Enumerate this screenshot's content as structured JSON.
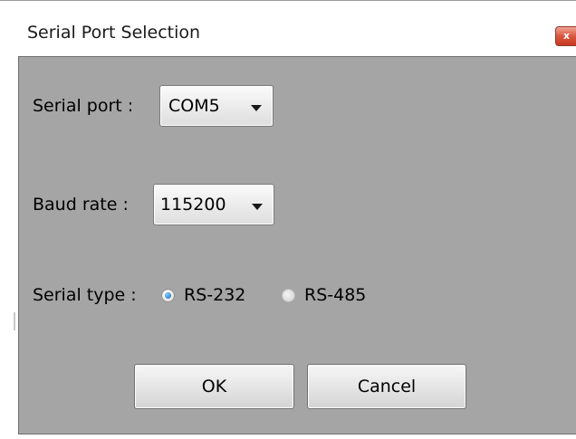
{
  "window": {
    "title": "Serial Port Selection",
    "close_icon": "close-icon",
    "close_glyph": "x",
    "accent": "#d9573f"
  },
  "form": {
    "serial_port": {
      "label": "Serial port :",
      "value": "COM5",
      "dropdown_icon": "chevron-down-icon"
    },
    "baud_rate": {
      "label": "Baud rate :",
      "value": "115200",
      "dropdown_icon": "chevron-down-icon"
    },
    "serial_type": {
      "label": "Serial type :",
      "options": [
        {
          "label": "RS-232",
          "selected": true,
          "enabled": true
        },
        {
          "label": "RS-485",
          "selected": false,
          "enabled": false
        }
      ]
    }
  },
  "buttons": {
    "ok_label": "OK",
    "cancel_label": "Cancel"
  },
  "colors": {
    "client_background": "#a5a5a5",
    "title_background": "#ffffff"
  }
}
